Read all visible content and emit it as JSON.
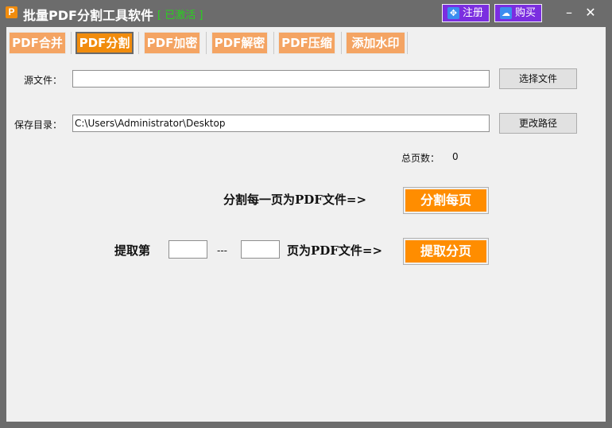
{
  "title_bar": {
    "icon_glyph": "P",
    "title": "批量PDF分割工具软件",
    "status": "[ 已激活 ]",
    "register_label": "注册",
    "buy_label": "购买",
    "minimize_glyph": "–",
    "close_glyph": "✕"
  },
  "tabs": [
    {
      "label": "PDF合并",
      "active": false
    },
    {
      "label": "PDF分割",
      "active": true
    },
    {
      "label": "PDF加密",
      "active": false
    },
    {
      "label": "PDF解密",
      "active": false
    },
    {
      "label": "PDF压缩",
      "active": false
    },
    {
      "label": "添加水印",
      "active": false
    }
  ],
  "source": {
    "label": "源文件：",
    "value": "",
    "button": "选择文件"
  },
  "save_dir": {
    "label": "保存目录：",
    "value": "C:\\Users\\Administrator\\Desktop",
    "button": "更改路径"
  },
  "page_count": {
    "label": "总页数：",
    "value": "0"
  },
  "split_each": {
    "label": "分割每一页为PDF文件=>",
    "button": "分割每页"
  },
  "extract": {
    "label_prefix": "提取第",
    "from_value": "",
    "separator": "---",
    "label_suffix": "页为PDF文件=>",
    "to_value": "",
    "button": "提取分页"
  },
  "colors": {
    "accent_orange": "#ff8d00",
    "tab_inactive": "#f4a463",
    "title_button": "#7b2ee0",
    "activated_green": "#29d21e"
  },
  "icons": {
    "app": "pdf-app-icon",
    "register": "register-icon",
    "buy": "buy-icon"
  }
}
